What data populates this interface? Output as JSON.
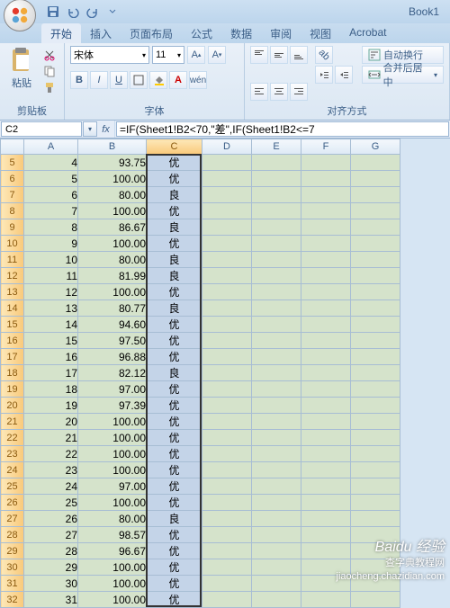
{
  "window": {
    "title": "Book1"
  },
  "qat": {
    "save": "save-icon",
    "undo": "undo-icon",
    "redo": "redo-icon"
  },
  "tabs": [
    "开始",
    "插入",
    "页面布局",
    "公式",
    "数据",
    "审阅",
    "视图",
    "Acrobat"
  ],
  "active_tab": 0,
  "ribbon": {
    "clipboard": {
      "paste": "粘贴",
      "label": "剪贴板"
    },
    "font": {
      "name": "宋体",
      "size": "11",
      "label": "字体",
      "bold": "B",
      "italic": "I",
      "underline": "U"
    },
    "alignment": {
      "label": "对齐方式",
      "wrap": "自动换行",
      "merge": "合并后居中"
    }
  },
  "namebox": "C2",
  "formula": "=IF(Sheet1!B2<70,\"差\",IF(Sheet1!B2<=7",
  "columns": [
    "A",
    "B",
    "C",
    "D",
    "E",
    "F",
    "G"
  ],
  "selected_col": "C",
  "rows": [
    {
      "n": 5,
      "a": "4",
      "b": "93.75",
      "c": "优"
    },
    {
      "n": 6,
      "a": "5",
      "b": "100.00",
      "c": "优"
    },
    {
      "n": 7,
      "a": "6",
      "b": "80.00",
      "c": "良"
    },
    {
      "n": 8,
      "a": "7",
      "b": "100.00",
      "c": "优"
    },
    {
      "n": 9,
      "a": "8",
      "b": "86.67",
      "c": "良"
    },
    {
      "n": 10,
      "a": "9",
      "b": "100.00",
      "c": "优"
    },
    {
      "n": 11,
      "a": "10",
      "b": "80.00",
      "c": "良"
    },
    {
      "n": 12,
      "a": "11",
      "b": "81.99",
      "c": "良"
    },
    {
      "n": 13,
      "a": "12",
      "b": "100.00",
      "c": "优"
    },
    {
      "n": 14,
      "a": "13",
      "b": "80.77",
      "c": "良"
    },
    {
      "n": 15,
      "a": "14",
      "b": "94.60",
      "c": "优"
    },
    {
      "n": 16,
      "a": "15",
      "b": "97.50",
      "c": "优"
    },
    {
      "n": 17,
      "a": "16",
      "b": "96.88",
      "c": "优"
    },
    {
      "n": 18,
      "a": "17",
      "b": "82.12",
      "c": "良"
    },
    {
      "n": 19,
      "a": "18",
      "b": "97.00",
      "c": "优"
    },
    {
      "n": 20,
      "a": "19",
      "b": "97.39",
      "c": "优"
    },
    {
      "n": 21,
      "a": "20",
      "b": "100.00",
      "c": "优"
    },
    {
      "n": 22,
      "a": "21",
      "b": "100.00",
      "c": "优"
    },
    {
      "n": 23,
      "a": "22",
      "b": "100.00",
      "c": "优"
    },
    {
      "n": 24,
      "a": "23",
      "b": "100.00",
      "c": "优"
    },
    {
      "n": 25,
      "a": "24",
      "b": "97.00",
      "c": "优"
    },
    {
      "n": 26,
      "a": "25",
      "b": "100.00",
      "c": "优"
    },
    {
      "n": 27,
      "a": "26",
      "b": "80.00",
      "c": "良"
    },
    {
      "n": 28,
      "a": "27",
      "b": "98.57",
      "c": "优"
    },
    {
      "n": 29,
      "a": "28",
      "b": "96.67",
      "c": "优"
    },
    {
      "n": 30,
      "a": "29",
      "b": "100.00",
      "c": "优"
    },
    {
      "n": 31,
      "a": "30",
      "b": "100.00",
      "c": "优"
    },
    {
      "n": 32,
      "a": "31",
      "b": "100.00",
      "c": "优"
    }
  ],
  "watermark": {
    "line1": "Baidu 经验",
    "line2": "查字典教程网",
    "line3": "jiaocheng.chazidian.com"
  }
}
